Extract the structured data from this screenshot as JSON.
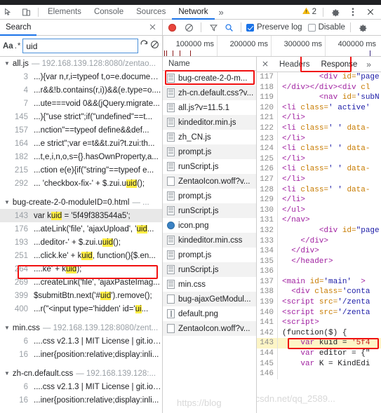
{
  "devtools_tabs": {
    "inspect_icon": "inspect-element-icon",
    "device_icon": "device-toolbar-icon",
    "items": [
      {
        "label": "Elements",
        "active": false
      },
      {
        "label": "Console",
        "active": false
      },
      {
        "label": "Sources",
        "active": false
      },
      {
        "label": "Network",
        "active": true
      }
    ],
    "more_label": "»",
    "warning_count": "2",
    "warning_icon": "warning-triangle-icon",
    "settings_icon": "gear-icon",
    "menu_icon": "vertical-dots-icon",
    "close_icon": "close-icon"
  },
  "search_pane": {
    "title": "Search",
    "close_icon": "close-icon",
    "match_case_label": "Aa",
    "regex_label": ".*",
    "query": "uid",
    "placeholder": "Search",
    "refresh_icon": "refresh-icon",
    "clear_icon": "clear-icon",
    "groups": [
      {
        "file": "all.js",
        "url": "— 192.168.139.128:8080/zentao...",
        "results": [
          {
            "line": "3",
            "text": "...){var n,r,i=typeof t,o=e.document..."
          },
          {
            "line": "4",
            "text": "...r&&!b.contains(r,i))&&(e.type=o...."
          },
          {
            "line": "7",
            "text": "...ute===void 0&&(jQuery.migrate..."
          },
          {
            "line": "145",
            "text": "...){\"use strict\";if(\"undefined\"==t..."
          },
          {
            "line": "157",
            "text": "...nction\"==typeof define&&def..."
          },
          {
            "line": "164",
            "text": "...e strict\";var e=t&&t.zui?t.zui:th..."
          },
          {
            "line": "182",
            "text": "...t,e,i,n,o,s={}.hasOwnProperty,a..."
          },
          {
            "line": "215",
            "text": "...ction e(e){if(\"string\"==typeof e..."
          },
          {
            "line": "292",
            "pre": "... 'checkbox-fix-' + $.zui.u",
            "hl": "uid",
            "post": "();"
          }
        ]
      },
      {
        "file": "bug-create-2-0-moduleID=0.html",
        "url": "— ...",
        "results": [
          {
            "line": "143",
            "pre": "var k",
            "hl": "uid",
            "post": " = '5f49f383544a5';",
            "selected": true,
            "boxed": true
          },
          {
            "line": "176",
            "pre": "...ateLink('file', 'ajaxUpload', '",
            "hl": "uid",
            "post": "..."
          },
          {
            "line": "193",
            "pre": "...deditor-' + $.zui.u",
            "hl": "uid",
            "post": "();"
          },
          {
            "line": "251",
            "pre": "...click.ke' + k",
            "hl": "uid",
            "post": ", function(){$.en..."
          },
          {
            "line": "264",
            "pre": "....ke' + k",
            "hl": "uid",
            "post": ");"
          },
          {
            "line": "269",
            "text": "...createLink('file', 'ajaxPasteImag..."
          },
          {
            "line": "399",
            "pre": "$submitBtn.next('#",
            "hl": "uid",
            "post": "').remove();"
          },
          {
            "line": "400",
            "pre": "...r(\"<input type='hidden' id='",
            "hl": "ui",
            "post": "..."
          }
        ]
      },
      {
        "file": "min.css",
        "url": "— 192.168.139.128:8080/zent...",
        "results": [
          {
            "line": "6",
            "text": "....css v2.1.3 | MIT License | git.io/n..."
          },
          {
            "line": "16",
            "text": "...iner{position:relative;display:inli..."
          }
        ]
      },
      {
        "file": "zh-cn.default.css",
        "url": "— 192.168.139.128:...",
        "results": [
          {
            "line": "6",
            "text": "....css v2.1.3 | MIT License | git.io/n..."
          },
          {
            "line": "16",
            "text": "...iner{position:relative;display:inli..."
          }
        ]
      }
    ]
  },
  "network_toolbar": {
    "record_icon": "record-button-icon",
    "clear_icon": "clear-icon",
    "filter_icon": "filter-icon",
    "search_icon": "search-icon",
    "preserve_log_label": "Preserve log",
    "preserve_log_checked": true,
    "disable_cache_label": "Disable",
    "disable_cache_checked": false,
    "settings_icon": "gear-icon"
  },
  "timeline": {
    "ticks": [
      "100000 ms",
      "200000 ms",
      "300000 ms",
      "400000 ms"
    ]
  },
  "requests_pane": {
    "column_header": "Name",
    "watermark": "https://blog",
    "rows": [
      {
        "name": "bug-create-2-0-m...",
        "icon": "document-icon",
        "boxed": true
      },
      {
        "name": "zh-cn.default.css?v...",
        "icon": "document-icon"
      },
      {
        "name": "all.js?v=11.5.1",
        "icon": "document-icon"
      },
      {
        "name": "kindeditor.min.js",
        "icon": "document-icon"
      },
      {
        "name": "zh_CN.js",
        "icon": "document-icon"
      },
      {
        "name": "prompt.js",
        "icon": "document-icon"
      },
      {
        "name": "runScript.js",
        "icon": "document-icon"
      },
      {
        "name": "ZentaoIcon.woff?v...",
        "icon": "plain-file-icon"
      },
      {
        "name": "prompt.js",
        "icon": "document-icon"
      },
      {
        "name": "runScript.js",
        "icon": "document-icon"
      },
      {
        "name": "icon.png",
        "icon": "image-icon"
      },
      {
        "name": "kindeditor.min.css",
        "icon": "document-icon"
      },
      {
        "name": "prompt.js",
        "icon": "document-icon"
      },
      {
        "name": "runScript.js",
        "icon": "document-icon"
      },
      {
        "name": "min.css",
        "icon": "document-icon"
      },
      {
        "name": "bug-ajaxGetModul...",
        "icon": "plain-file-icon"
      },
      {
        "name": "default.png",
        "icon": "bar-file-icon"
      },
      {
        "name": "ZentaoIcon.woff?v...",
        "icon": "plain-file-icon"
      }
    ]
  },
  "response_pane": {
    "close_icon": "close-icon",
    "tabs": [
      {
        "label": "Headers",
        "active": false
      },
      {
        "label": "Response",
        "active": true,
        "boxed": true
      }
    ],
    "more_label": "»",
    "watermark": ".csdn.net/qq_2589...",
    "lines": [
      {
        "n": "117",
        "segs": [
          {
            "t": "        ",
            "c": "pl"
          },
          {
            "t": "<div",
            "c": "tg"
          },
          {
            "t": " id=",
            "c": "at"
          },
          {
            "t": "\"page ",
            "c": "vl"
          }
        ]
      },
      {
        "n": "118",
        "segs": [
          {
            "t": "</div></div><div",
            "c": "tg"
          },
          {
            "t": " cl",
            "c": "at"
          }
        ]
      },
      {
        "n": "119",
        "segs": [
          {
            "t": "        ",
            "c": "pl"
          },
          {
            "t": "<nav",
            "c": "tg"
          },
          {
            "t": " id=",
            "c": "at"
          },
          {
            "t": "'subN",
            "c": "vl"
          }
        ]
      },
      {
        "n": "120",
        "segs": [
          {
            "t": "<li",
            "c": "tg"
          },
          {
            "t": " class=",
            "c": "at"
          },
          {
            "t": "' active'",
            "c": "vl"
          }
        ]
      },
      {
        "n": "121",
        "segs": [
          {
            "t": "</li>",
            "c": "tg"
          }
        ]
      },
      {
        "n": "122",
        "segs": [
          {
            "t": "<li",
            "c": "tg"
          },
          {
            "t": " class=",
            "c": "at"
          },
          {
            "t": "' '",
            "c": "vl"
          },
          {
            "t": " data-",
            "c": "at"
          }
        ]
      },
      {
        "n": "123",
        "segs": [
          {
            "t": "</li>",
            "c": "tg"
          }
        ]
      },
      {
        "n": "124",
        "segs": [
          {
            "t": "<li",
            "c": "tg"
          },
          {
            "t": " class=",
            "c": "at"
          },
          {
            "t": "' '",
            "c": "vl"
          },
          {
            "t": " data-",
            "c": "at"
          }
        ]
      },
      {
        "n": "125",
        "segs": [
          {
            "t": "</li>",
            "c": "tg"
          }
        ]
      },
      {
        "n": "126",
        "segs": [
          {
            "t": "<li",
            "c": "tg"
          },
          {
            "t": " class=",
            "c": "at"
          },
          {
            "t": "' '",
            "c": "vl"
          },
          {
            "t": " data-",
            "c": "at"
          }
        ]
      },
      {
        "n": "127",
        "segs": [
          {
            "t": "</li>",
            "c": "tg"
          }
        ]
      },
      {
        "n": "128",
        "segs": [
          {
            "t": "<li",
            "c": "tg"
          },
          {
            "t": " class=",
            "c": "at"
          },
          {
            "t": "' '",
            "c": "vl"
          },
          {
            "t": " data-",
            "c": "at"
          }
        ]
      },
      {
        "n": "129",
        "segs": [
          {
            "t": "</li>",
            "c": "tg"
          }
        ]
      },
      {
        "n": "130",
        "segs": [
          {
            "t": "</ul>",
            "c": "tg"
          }
        ]
      },
      {
        "n": "131",
        "segs": [
          {
            "t": "</nav>",
            "c": "tg"
          }
        ]
      },
      {
        "n": "132",
        "segs": [
          {
            "t": "        ",
            "c": "pl"
          },
          {
            "t": "<div",
            "c": "tg"
          },
          {
            "t": " id=",
            "c": "at"
          },
          {
            "t": "\"page",
            "c": "vl"
          }
        ]
      },
      {
        "n": "133",
        "segs": [
          {
            "t": "    ",
            "c": "pl"
          },
          {
            "t": "</div>",
            "c": "tg"
          }
        ]
      },
      {
        "n": "134",
        "segs": [
          {
            "t": "  ",
            "c": "pl"
          },
          {
            "t": "</div>",
            "c": "tg"
          }
        ]
      },
      {
        "n": "135",
        "segs": [
          {
            "t": "  ",
            "c": "pl"
          },
          {
            "t": "</header>",
            "c": "tg"
          }
        ]
      },
      {
        "n": "136",
        "segs": [
          {
            "t": "",
            "c": "pl"
          }
        ]
      },
      {
        "n": "137",
        "segs": [
          {
            "t": "<main",
            "c": "tg"
          },
          {
            "t": " id=",
            "c": "at"
          },
          {
            "t": "'main'",
            "c": "vl"
          },
          {
            "t": "  >",
            "c": "tg"
          }
        ]
      },
      {
        "n": "138",
        "segs": [
          {
            "t": "  ",
            "c": "pl"
          },
          {
            "t": "<div",
            "c": "tg"
          },
          {
            "t": " class=",
            "c": "at"
          },
          {
            "t": "'conta",
            "c": "vl"
          }
        ]
      },
      {
        "n": "139",
        "segs": [
          {
            "t": "<script",
            "c": "tg"
          },
          {
            "t": " src=",
            "c": "at"
          },
          {
            "t": "'/zenta",
            "c": "vl"
          }
        ]
      },
      {
        "n": "140",
        "segs": [
          {
            "t": "<script",
            "c": "tg"
          },
          {
            "t": " src=",
            "c": "at"
          },
          {
            "t": "'/zenta",
            "c": "vl"
          }
        ]
      },
      {
        "n": "141",
        "segs": [
          {
            "t": "<script>",
            "c": "tg"
          }
        ]
      },
      {
        "n": "142",
        "segs": [
          {
            "t": "(function($) {",
            "c": "pl"
          }
        ]
      },
      {
        "n": "143",
        "hl": true,
        "boxed": true,
        "segs": [
          {
            "t": "    ",
            "c": "pl"
          },
          {
            "t": "var",
            "c": "kw"
          },
          {
            "t": " kuid = ",
            "c": "pl"
          },
          {
            "t": "'5f4",
            "c": "st"
          }
        ]
      },
      {
        "n": "144",
        "segs": [
          {
            "t": "    ",
            "c": "pl"
          },
          {
            "t": "var",
            "c": "kw"
          },
          {
            "t": " editor = {\"",
            "c": "pl"
          }
        ]
      },
      {
        "n": "145",
        "segs": [
          {
            "t": "    ",
            "c": "pl"
          },
          {
            "t": "var",
            "c": "kw"
          },
          {
            "t": " K = KindEdi",
            "c": "pl"
          }
        ]
      },
      {
        "n": "146",
        "segs": [
          {
            "t": "",
            "c": "pl"
          }
        ]
      }
    ]
  }
}
